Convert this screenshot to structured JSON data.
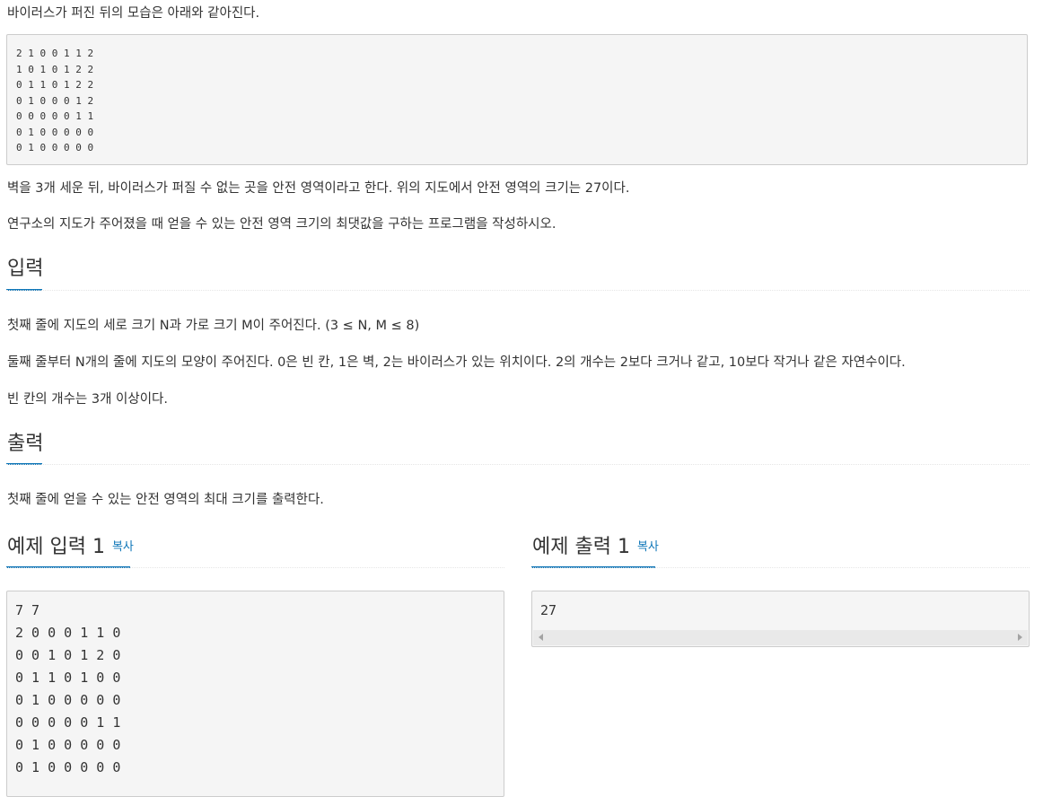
{
  "intro_text": "바이러스가 퍼진 뒤의 모습은 아래와 같아진다.",
  "grid_after": [
    "2 1 0 0 1 1 2",
    "1 0 1 0 1 2 2",
    "0 1 1 0 1 2 2",
    "0 1 0 0 0 1 2",
    "0 0 0 0 0 1 1",
    "0 1 0 0 0 0 0",
    "0 1 0 0 0 0 0"
  ],
  "paragraph_safe_area": "벽을 3개 세운 뒤, 바이러스가 퍼질 수 없는 곳을 안전 영역이라고 한다. 위의 지도에서 안전 영역의 크기는 27이다.",
  "paragraph_task": "연구소의 지도가 주어졌을 때 얻을 수 있는 안전 영역 크기의 최댓값을 구하는 프로그램을 작성하시오.",
  "input_section": {
    "title": "입력",
    "lines": [
      "첫째 줄에 지도의 세로 크기 N과 가로 크기 M이 주어진다. (3 ≤ N, M ≤ 8)",
      "둘째 줄부터 N개의 줄에 지도의 모양이 주어진다. 0은 빈 칸, 1은 벽, 2는 바이러스가 있는 위치이다. 2의 개수는 2보다 크거나 같고, 10보다 작거나 같은 자연수이다.",
      "빈 칸의 개수는 3개 이상이다."
    ]
  },
  "output_section": {
    "title": "출력",
    "lines": [
      "첫째 줄에 얻을 수 있는 안전 영역의 최대 크기를 출력한다."
    ]
  },
  "sample_input": {
    "title": "예제 입력 1",
    "copy_label": "복사",
    "lines": [
      "7 7",
      "2 0 0 0 1 1 0",
      "0 0 1 0 1 2 0",
      "0 1 1 0 1 0 0",
      "0 1 0 0 0 0 0",
      "0 0 0 0 0 1 1",
      "0 1 0 0 0 0 0",
      "0 1 0 0 0 0 0"
    ]
  },
  "sample_output": {
    "title": "예제 출력 1",
    "copy_label": "복사",
    "lines": [
      "27"
    ]
  },
  "colors": {
    "accent": "#0e76b8",
    "box_background": "#f5f5f5",
    "box_border": "#cccccc"
  }
}
